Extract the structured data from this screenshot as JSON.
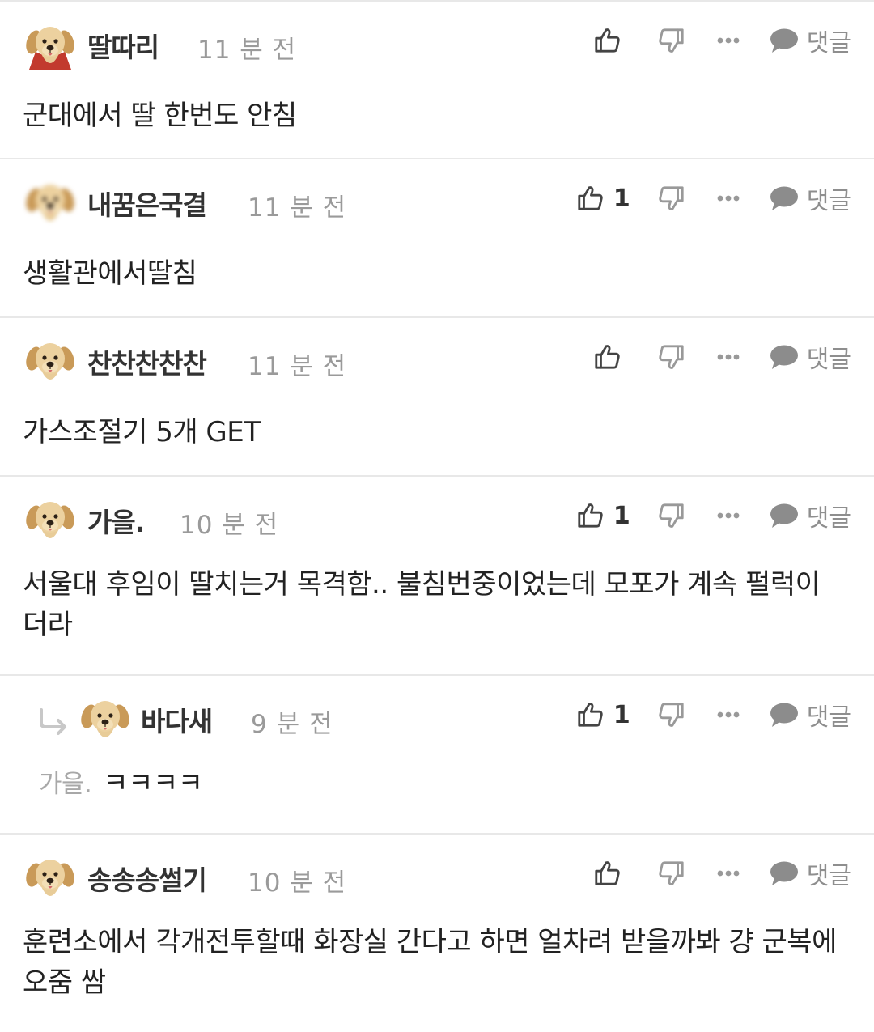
{
  "labels": {
    "reply": "댓글"
  },
  "colors": {
    "icon": "#8c8c8c",
    "icon_dark": "#444444",
    "reply_arrow": "#c8c8c8",
    "divider": "#e8e8e8"
  },
  "comments": [
    {
      "nickname": "딸따리",
      "time": "11 분 전",
      "likes": "",
      "text": "군대에서 딸 한번도 안침",
      "avatar": "dog-cape-avatar"
    },
    {
      "nickname": "내꿈은국결",
      "time": "11 분 전",
      "likes": "1",
      "text": "생활관에서딸침",
      "avatar": "blurred-dog-avatar"
    },
    {
      "nickname": "찬찬찬찬찬",
      "time": "11 분 전",
      "likes": "",
      "text": "가스조절기 5개 GET",
      "avatar": "dog-avatar"
    },
    {
      "nickname": "가을.",
      "time": "10 분 전",
      "likes": "1",
      "text": "서울대 후임이 딸치는거 목격함.. 불침번중이었는데 모포가 계속 펄럭이더라",
      "avatar": "dog-avatar"
    },
    {
      "nickname": "바다새",
      "time": "9 분 전",
      "likes": "1",
      "mention": "가을.",
      "text": "ㅋㅋㅋㅋ",
      "avatar": "dog-avatar",
      "is_reply": true
    },
    {
      "nickname": "송송송썰기",
      "time": "10 분 전",
      "likes": "",
      "text": "훈련소에서 각개전투할때 화장실 간다고 하면 얼차려 받을까봐 걍 군복에 오줌 쌈",
      "avatar": "dog-avatar"
    }
  ]
}
